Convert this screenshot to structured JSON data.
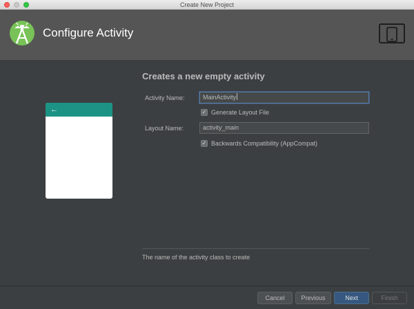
{
  "window": {
    "title": "Create New Project"
  },
  "header": {
    "title": "Configure Activity",
    "logo_icon": "android-studio-logo",
    "device_icon": "tablet-phone-icon"
  },
  "preview": {
    "back_icon": "←",
    "bar_color": "#1d9385"
  },
  "form": {
    "section_title": "Creates a new empty activity",
    "activity_name_label": "Activity Name:",
    "activity_name_value": "MainActivity",
    "generate_layout_label": "Generate Layout File",
    "generate_layout_checked": true,
    "layout_name_label": "Layout Name:",
    "layout_name_value": "activity_main",
    "backwards_compat_label": "Backwards Compatibility (AppCompat)",
    "backwards_compat_checked": true,
    "check_glyph": "✓"
  },
  "hint": {
    "text": "The name of the activity class to create"
  },
  "buttons": {
    "cancel": "Cancel",
    "previous": "Previous",
    "next": "Next",
    "finish": "Finish"
  }
}
